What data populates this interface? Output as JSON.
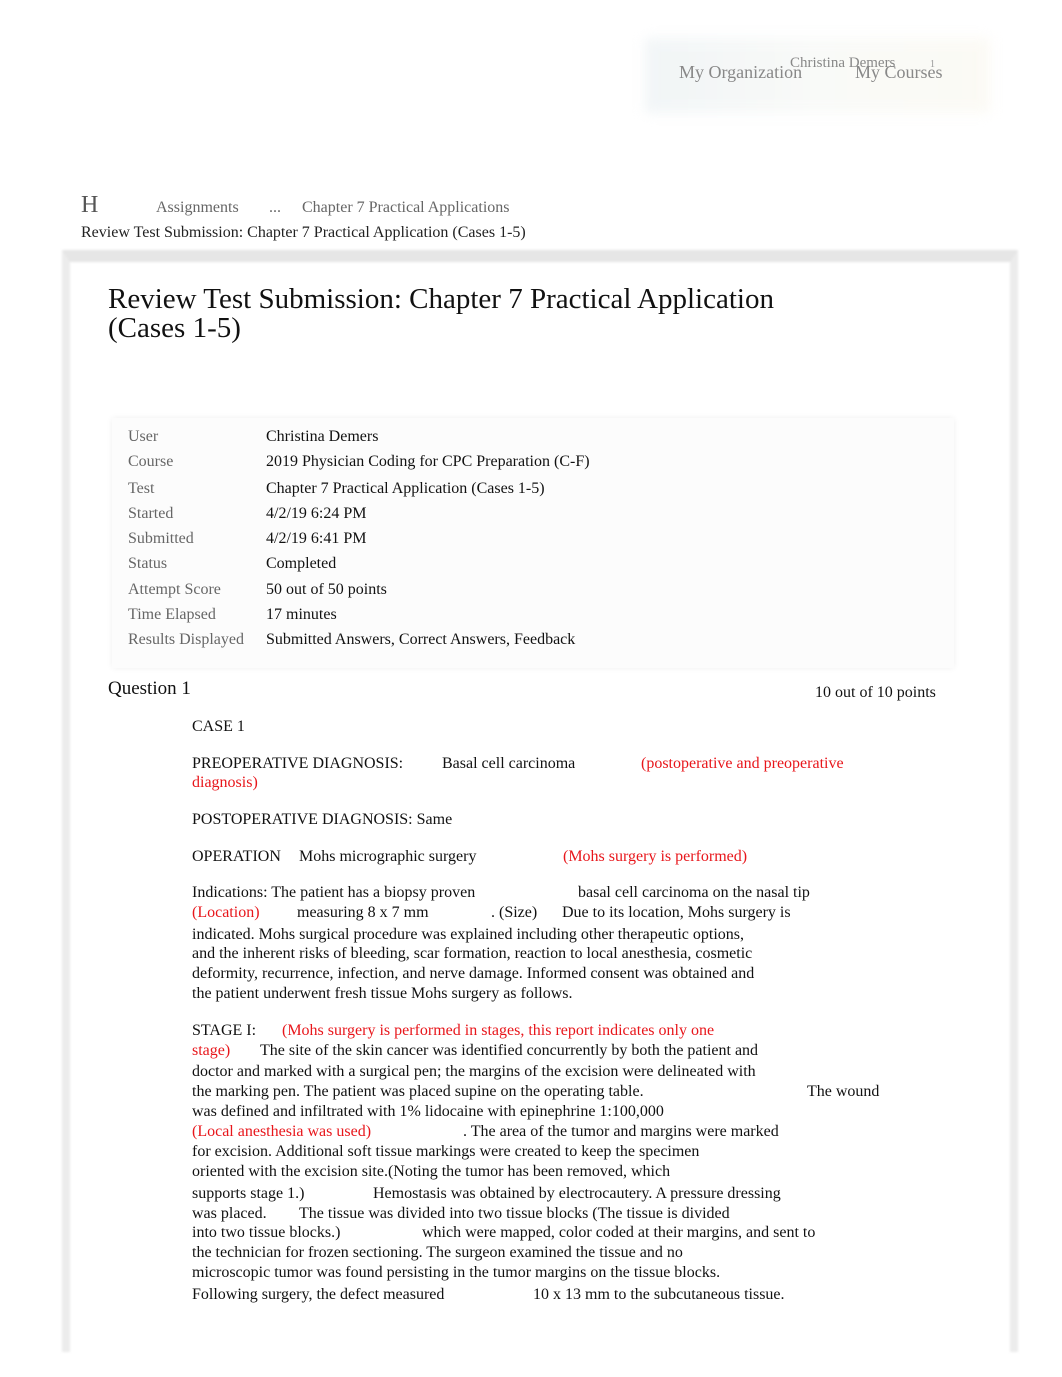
{
  "header": {
    "nav_org": "My Organization",
    "nav_courses": "My Courses",
    "user_name": "Christina Demers",
    "notification_count": "1"
  },
  "breadcrumb": {
    "home": "H",
    "assignments": "Assignments",
    "ellipsis": "...",
    "chapter": "Chapter 7 Practical Applications",
    "current": "Review Test Submission: Chapter 7 Practical Application (Cases 1-5)"
  },
  "page_title_line1": "Review Test Submission: Chapter 7 Practical Application",
  "page_title_line2": "(Cases 1-5)",
  "info": [
    {
      "label": "User",
      "value": "Christina Demers"
    },
    {
      "label": "Course",
      "value": "2019 Physician Coding for CPC Preparation (C-F)"
    },
    {
      "label": "Test",
      "value": "Chapter 7 Practical Application (Cases 1-5)"
    },
    {
      "label": "Started",
      "value": "4/2/19 6:24 PM"
    },
    {
      "label": "Submitted",
      "value": "4/2/19 6:41 PM"
    },
    {
      "label": "Status",
      "value": "Completed"
    },
    {
      "label": "Attempt Score",
      "value": "50 out of 50 points"
    },
    {
      "label": "Time Elapsed",
      "value": "17 minutes"
    },
    {
      "label": "Results Displayed",
      "value": "Submitted Answers, Correct Answers, Feedback"
    }
  ],
  "question": {
    "title": "Question 1",
    "points": "10 out of 10 points"
  },
  "colors": {
    "feedback": "#e8161b"
  },
  "case_lines": [
    [
      {
        "t": "CASE 1"
      }
    ],
    [
      {
        "t": "PREOPERATIVE DIAGNOSIS:"
      },
      {
        "t": "Basal cell carcinoma"
      },
      {
        "t": "(postoperative and preoperative",
        "red": true
      }
    ],
    [
      {
        "t": "diagnosis)",
        "red": true
      }
    ],
    [
      {
        "t": "POSTOPERATIVE DIAGNOSIS: Same"
      }
    ],
    [
      {
        "t": "OPERATION"
      },
      {
        "t": "Mohs micrographic surgery"
      },
      {
        "t": "(Mohs surgery is performed)",
        "red": true
      }
    ],
    [
      {
        "t": "Indications: The patient has a biopsy proven"
      },
      {
        "t": "basal cell carcinoma on the nasal tip"
      }
    ],
    [
      {
        "t": "(Location)",
        "red": true
      },
      {
        "t": "measuring 8 x 7 mm"
      },
      {
        "t": ". (Size)"
      },
      {
        "t": "Due to its location, Mohs surgery is"
      }
    ],
    [
      {
        "t": "indicated. Mohs surgical procedure was explained including other therapeutic options,"
      }
    ],
    [
      {
        "t": "and the inherent risks of bleeding, scar formation, reaction to local anesthesia, cosmetic"
      }
    ],
    [
      {
        "t": "deformity, recurrence, infection, and nerve damage. Informed consent was obtained and"
      }
    ],
    [
      {
        "t": "the patient underwent fresh tissue Mohs surgery as follows."
      }
    ],
    [
      {
        "t": "STAGE I:"
      },
      {
        "t": "(Mohs surgery is performed in stages, this report indicates only one",
        "red": true
      }
    ],
    [
      {
        "t": "stage)",
        "red": true
      },
      {
        "t": "The site of the skin cancer was identified concurrently by both the patient and"
      }
    ],
    [
      {
        "t": "doctor and marked with a surgical pen; the margins of the excision were delineated with"
      }
    ],
    [
      {
        "t": "the marking pen. The patient was placed supine on the operating table."
      },
      {
        "t": "The wound"
      }
    ],
    [
      {
        "t": "was defined and infiltrated with 1% lidocaine with epinephrine 1:100,000"
      }
    ],
    [
      {
        "t": "(Local anesthesia was used)",
        "red": true
      },
      {
        "t": ". The area of the tumor and margins were marked"
      }
    ],
    [
      {
        "t": "for excision. Additional soft tissue markings were created to keep the specimen"
      }
    ],
    [
      {
        "t": "oriented with the excision site.(Noting the tumor has been removed, which"
      }
    ],
    [
      {
        "t": "supports stage 1.)"
      },
      {
        "t": "Hemostasis was obtained by electrocautery. A pressure dressing"
      }
    ],
    [
      {
        "t": "was placed."
      },
      {
        "t": "The tissue was divided into two tissue blocks (The tissue is divided"
      }
    ],
    [
      {
        "t": "into two tissue blocks.)"
      },
      {
        "t": "which were mapped, color coded at their margins, and sent to"
      }
    ],
    [
      {
        "t": "the technician for frozen sectioning. The surgeon examined the tissue and no"
      }
    ],
    [
      {
        "t": "microscopic tumor was found persisting in the tumor margins on the tissue blocks."
      }
    ],
    [
      {
        "t": "Following surgery, the defect measured"
      },
      {
        "t": "10 x 13 mm to the subcutaneous tissue."
      }
    ]
  ]
}
